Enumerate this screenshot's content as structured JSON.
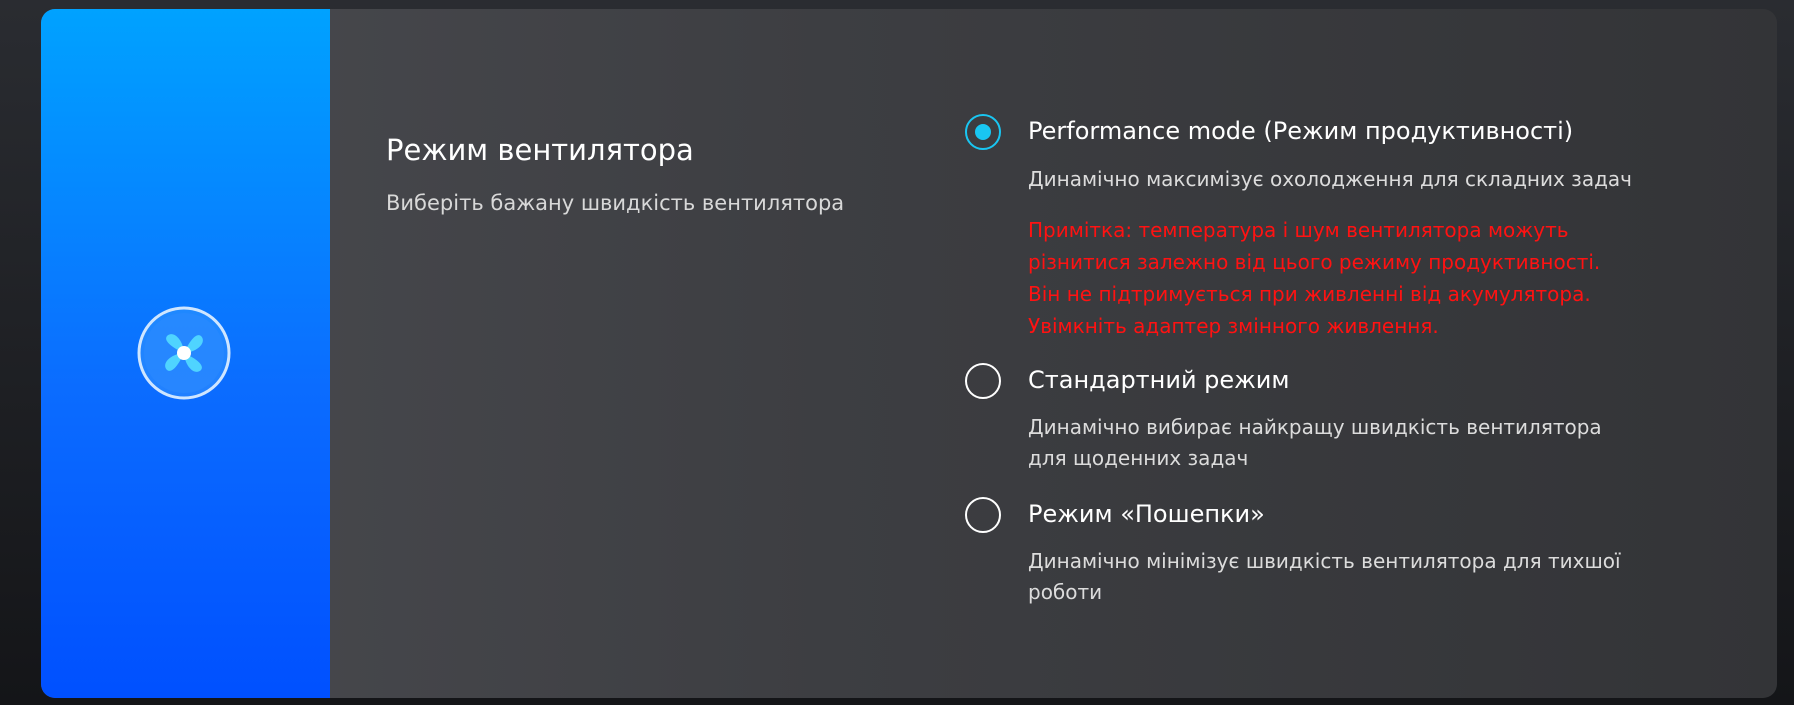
{
  "section": {
    "title": "Режим вентилятора",
    "subtitle": "Виберіть бажану швидкість вентилятора"
  },
  "icons": {
    "fan": "fan-icon"
  },
  "colors": {
    "accent": "#19c6f2",
    "warning": "#ff1212",
    "panel_blue": "#0b6cff"
  },
  "options": [
    {
      "title": "Performance mode (Режим продуктивності)",
      "desc_lines": [
        "Динамічно максимізує охолодження для складних задач"
      ],
      "note_lines": [
        "Примітка: температура і шум вентилятора можуть",
        "різнитися залежно від цього режиму продуктивності.",
        "Він не підтримується при живленні від акумулятора.",
        "Увімкніть адаптер змінного живлення."
      ],
      "selected": true
    },
    {
      "title": "Стандартний режим",
      "desc_lines": [
        "Динамічно вибирає найкращу швидкість вентилятора",
        "для щоденних задач"
      ],
      "selected": false
    },
    {
      "title": "Режим «Пошепки»",
      "desc_lines": [
        "Динамічно мінімізує швидкість вентилятора для тихшої",
        "роботи"
      ],
      "selected": false
    }
  ]
}
